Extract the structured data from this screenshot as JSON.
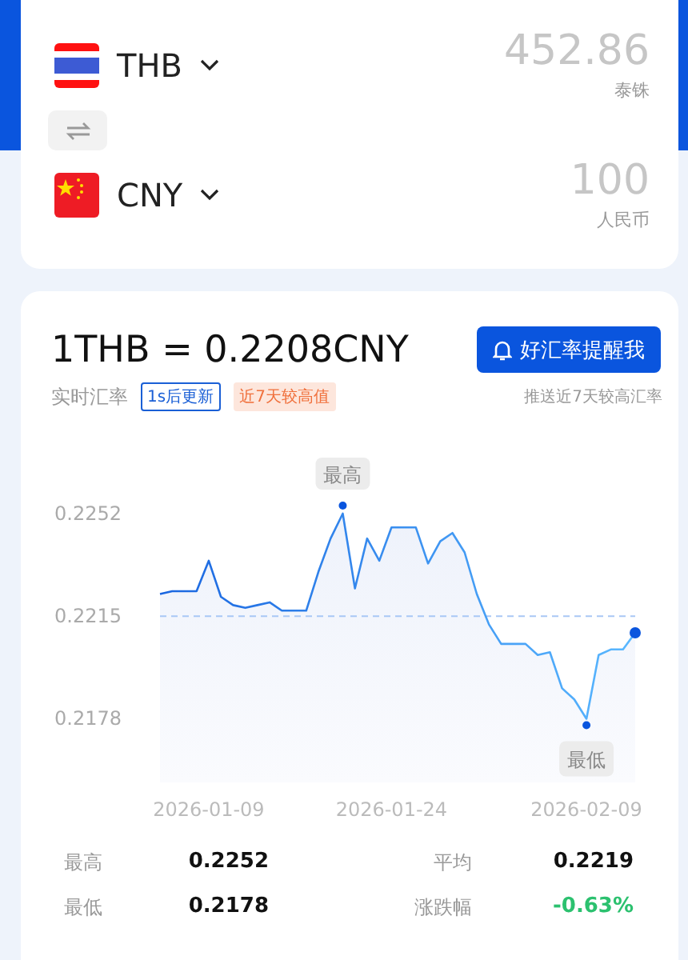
{
  "converter": {
    "rows": [
      {
        "code": "THB",
        "amount": "452.86",
        "currency_name": "泰铢"
      },
      {
        "code": "CNY",
        "amount": "100",
        "currency_name": "人民币"
      }
    ]
  },
  "rate": {
    "title": "1THB = 0.2208CNY",
    "alert_button": "好汇率提醒我",
    "label": "实时汇率",
    "update_badge": "1s后更新",
    "high_badge": "近7天较高值",
    "push_note": "推送近7天较高汇率"
  },
  "chart": {
    "chart_data": {
      "type": "area",
      "ylim": [
        0.2178,
        0.2252
      ],
      "yticks": [
        0.2178,
        0.2215,
        0.2252
      ],
      "categories": [
        null,
        null,
        null,
        null,
        "2026-01-09",
        null,
        null,
        null,
        null,
        null,
        null,
        null,
        null,
        null,
        null,
        null,
        null,
        null,
        null,
        "2026-01-24",
        null,
        null,
        null,
        null,
        null,
        null,
        null,
        null,
        null,
        null,
        null,
        null,
        null,
        null,
        null,
        "2026-02-09",
        null,
        null,
        null,
        null
      ],
      "series": [
        {
          "color": "#1a66e0",
          "values": [
            0.2223,
            0.2224,
            0.2224,
            0.2224,
            0.2235,
            0.2222,
            0.2219,
            0.2218,
            0.2219,
            0.222,
            0.2217,
            0.2217,
            0.2217,
            0.2231,
            0.2243,
            0.2252,
            0.2225,
            0.2243,
            0.2235,
            0.2247,
            0.2247,
            0.2247,
            0.2234,
            0.2242,
            0.2245,
            0.2238,
            0.2223,
            0.2212,
            0.2205,
            0.2205,
            0.2205,
            0.2201,
            0.2202,
            0.2189,
            0.2185,
            0.2178,
            0.2201,
            0.2203,
            0.2203,
            0.2209
          ]
        }
      ],
      "ref_lines": [
        {
          "axis": "y",
          "value": 0.2215
        }
      ],
      "annotations": [
        {
          "y": 0.2252,
          "text": "最高"
        },
        {
          "y": 0.2178,
          "text": "最低"
        }
      ]
    }
  },
  "stats": [
    {
      "label": "最高",
      "value": "0.2252",
      "color": "#111111"
    },
    {
      "label": "平均",
      "value": "0.2219",
      "color": "#111111"
    },
    {
      "label": "最低",
      "value": "0.2178",
      "color": "#111111"
    },
    {
      "label": "涨跌幅",
      "value": "-0.63%",
      "color": "#2cc16f"
    }
  ]
}
